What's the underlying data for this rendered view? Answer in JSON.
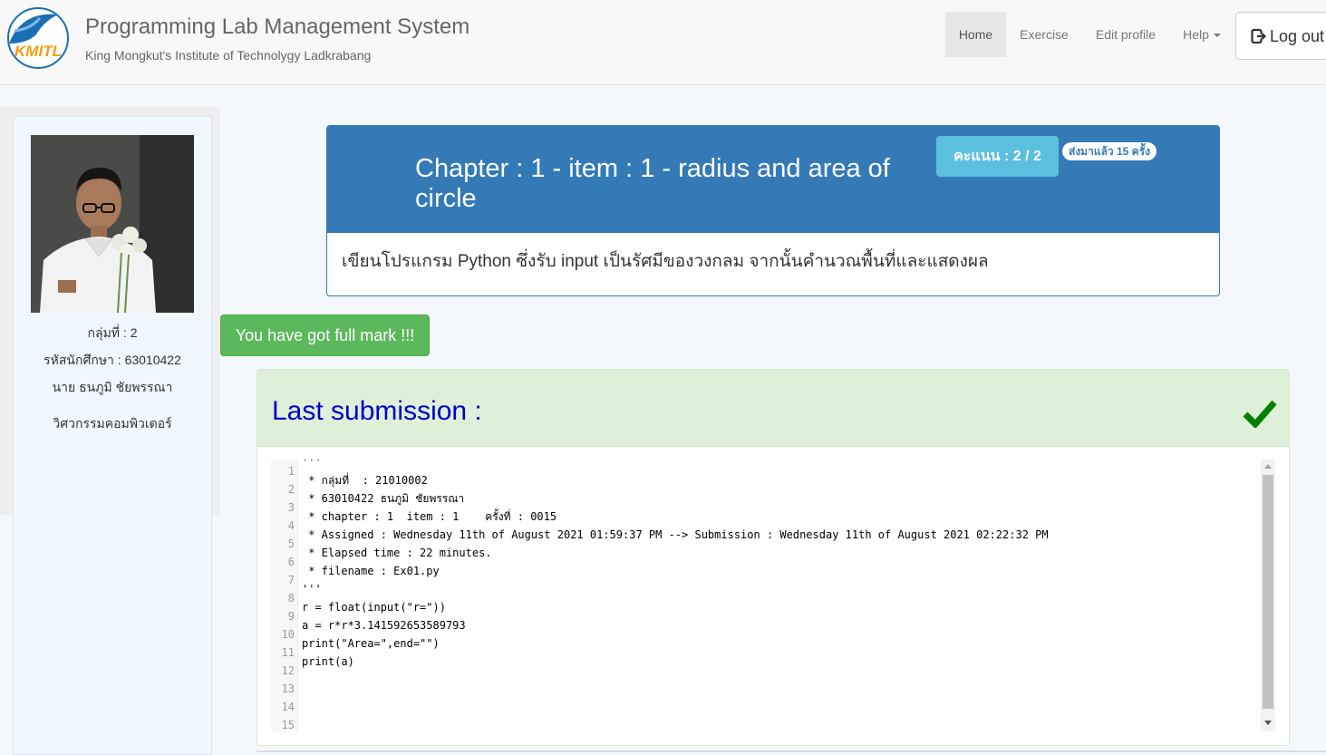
{
  "header": {
    "logo_text": "KMITL",
    "title": "Programming Lab Management System",
    "subtitle": "King Mongkut's Institute of Technolygy Ladkrabang",
    "nav": {
      "home": "Home",
      "exercise": "Exercise",
      "edit_profile": "Edit profile",
      "help": "Help",
      "logout": "Log out"
    },
    "active_nav": "Home"
  },
  "student": {
    "group": "กลุ่มที่ : 2",
    "student_id": "รหัสนักศึกษา : 63010422",
    "name": "นาย ธนภูมิ ชัยพรรณา",
    "department": "วิศวกรรมคอมพิวเตอร์"
  },
  "exercise": {
    "title": "Chapter : 1 - item : 1 - radius and area of circle",
    "score": "คะแนน : 2 / 2",
    "submission_count": "ส่งมาแล้ว 15 ครั้ง",
    "description": "เขียนโปรแกรม Python ซึ่งรับ input เป็นรัศมีของวงกลม จากนั้นคำนวณพื้นที่และแสดงผล"
  },
  "result": {
    "full_mark": "You have got full mark !!!"
  },
  "submission": {
    "title": "Last submission :",
    "status_icon": "check-icon",
    "lines": [
      "'''",
      " * กลุ่มที่  : 21010002",
      " * 63010422 ธนภูมิ ชัยพรรณา",
      " * chapter : 1  item : 1    ครั้งที่ : 0015",
      " * Assigned : Wednesday 11th of August 2021 01:59:37 PM --> Submission : Wednesday 11th of August 2021 02:22:32 PM",
      " * Elapsed time : 22 minutes.",
      " * filename : Ex01.py",
      "'''",
      "r = float(input(\"r=\"))",
      "a = r*r*3.141592653589793",
      "print(\"Area=\",end=\"\")",
      "print(a)",
      "",
      "",
      ""
    ],
    "line_numbers": [
      "1",
      "2",
      "3",
      "4",
      "5",
      "6",
      "7",
      "8",
      "9",
      "10",
      "11",
      "12",
      "13",
      "14",
      "15"
    ]
  },
  "colors": {
    "primary": "#337ab7",
    "info": "#5bc0de",
    "success": "#5cb85c",
    "success_bg": "#dff0d8",
    "submission_title": "#0000cc",
    "check": "#008000"
  }
}
